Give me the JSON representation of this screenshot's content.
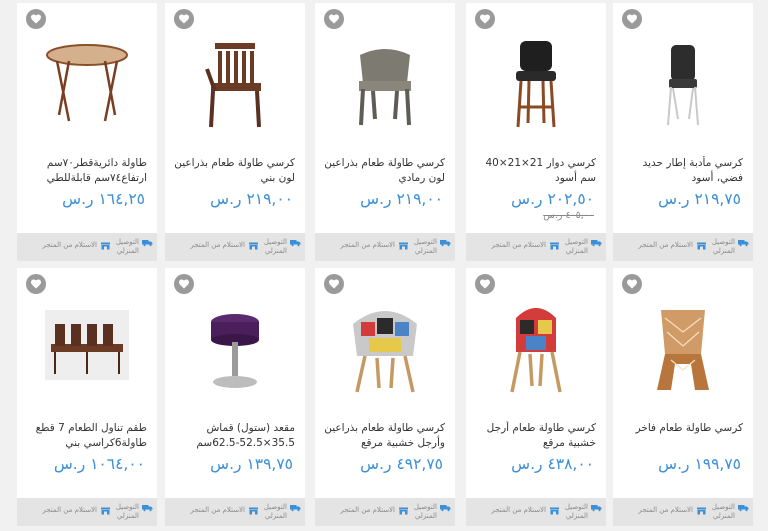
{
  "labels": {
    "delivery": "التوصيل المنزلي",
    "pickup": "الاستلام من المتجر"
  },
  "colors": {
    "price": "#3b8fd6",
    "favorite_badge": "#9a9a9a",
    "footer_bg": "#e4e4e4"
  },
  "products": [
    {
      "name": "كرسي مأدبة إطار حديد فضي، أسود",
      "price": "٢١٩,٧٥ ر.س",
      "old_price": "",
      "image": "banquet-chair"
    },
    {
      "name": "كرسي دوار 21×21×40 سم أسود",
      "price": "٢٠٢,٥٠ ر.س",
      "old_price": "٤٠٥,٠٠ ر.س",
      "image": "bar-stool"
    },
    {
      "name": "كرسي طاولة طعام بذراعين لون رمادي",
      "price": "٢١٩,٠٠ ر.س",
      "old_price": "",
      "image": "gray-armchair"
    },
    {
      "name": "كرسي طاولة طعام بذراعين لون بني",
      "price": "٢١٩,٠٠ ر.س",
      "old_price": "",
      "image": "brown-armchair"
    },
    {
      "name": "طاولة دائريةقطر٧٠سم ارتفاع٧٤سم قابلةللطي",
      "price": "١٦٤,٢٥ ر.س",
      "old_price": "",
      "image": "round-table"
    },
    {
      "name": "كرسي طاولة طعام فاخر",
      "price": "١٩٩,٧٥ ر.س",
      "old_price": "",
      "image": "gold-chair"
    },
    {
      "name": "كرسي طاولة طعام أرجل خشبية مرقع",
      "price": "٤٣٨,٠٠ ر.س",
      "old_price": "",
      "image": "patchwork-chair"
    },
    {
      "name": "كرسي طاولة طعام بذراعين وأرجل خشبية مرقع",
      "price": "٤٩٢,٧٥ ر.س",
      "old_price": "",
      "image": "patchwork-armchair"
    },
    {
      "name": "مقعد (ستول) قماش 35.5×52.5-62.5سم",
      "price": "١٣٩,٧٥ ر.س",
      "old_price": "",
      "image": "purple-stool"
    },
    {
      "name": "طقم تناول الطعام 7 قطع طاولة6كراسي بني",
      "price": "١٠٦٤,٠٠ ر.س",
      "old_price": "",
      "image": "dining-set"
    }
  ]
}
